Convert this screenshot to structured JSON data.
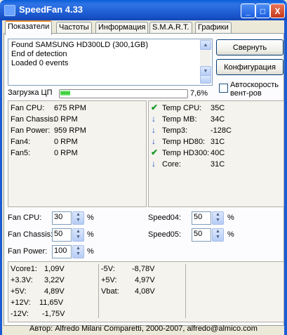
{
  "window": {
    "title": "SpeedFan 4.33",
    "minimize": "_",
    "maximize": "□",
    "close": "X"
  },
  "tabs": [
    "Показатели",
    "Частоты",
    "Информация",
    "S.M.A.R.T.",
    "Графики"
  ],
  "log": {
    "lines": [
      "Found SAMSUNG HD300LD (300,1GB)",
      "End of detection",
      "Loaded 0 events"
    ]
  },
  "buttons": {
    "minimize_label": "Свернуть",
    "config_label": "Конфигурация"
  },
  "autospeed": {
    "label_line1": "Автоскорость",
    "label_line2": "вент-ров",
    "checked": false
  },
  "cpu_load": {
    "label": "Загрузка ЦП",
    "value_text": "7,6%",
    "fraction": 0.076
  },
  "fans": [
    {
      "name": "Fan CPU:",
      "value": "675 RPM"
    },
    {
      "name": "Fan Chassis:",
      "value": "0 RPM"
    },
    {
      "name": "Fan Power:",
      "value": "959 RPM"
    },
    {
      "name": "Fan4:",
      "value": "0 RPM"
    },
    {
      "name": "Fan5:",
      "value": "0 RPM"
    }
  ],
  "temps": [
    {
      "name": "Temp CPU:",
      "value": "35C",
      "icon": "check"
    },
    {
      "name": "Temp MB:",
      "value": "34C",
      "icon": "arrow-down"
    },
    {
      "name": "Temp3:",
      "value": "-128C",
      "icon": "arrow-down"
    },
    {
      "name": "Temp HD80:",
      "value": "31C",
      "icon": "arrow-down"
    },
    {
      "name": "Temp HD300:",
      "value": "40C",
      "icon": "check"
    },
    {
      "name": "Core:",
      "value": "31C",
      "icon": "arrow-down"
    }
  ],
  "speeds": [
    {
      "label": "Fan CPU:",
      "value": "30",
      "unit": "%"
    },
    {
      "label": "Fan Chassis:",
      "value": "50",
      "unit": "%"
    },
    {
      "label": "Fan Power:",
      "value": "100",
      "unit": "%"
    },
    {
      "label": "Speed04:",
      "value": "50",
      "unit": "%"
    },
    {
      "label": "Speed05:",
      "value": "50",
      "unit": "%"
    }
  ],
  "voltages_left": [
    {
      "name": "Vcore1:",
      "value": "1,09V"
    },
    {
      "name": "+3.3V:",
      "value": "3,22V"
    },
    {
      "name": "+5V:",
      "value": "4,89V"
    },
    {
      "name": "+12V:",
      "value": "11,65V"
    },
    {
      "name": "-12V:",
      "value": "-1,75V"
    }
  ],
  "voltages_right": [
    {
      "name": "-5V:",
      "value": "-8,78V"
    },
    {
      "name": "+5V:",
      "value": "4,97V"
    },
    {
      "name": "Vbat:",
      "value": "4,08V"
    }
  ],
  "footer": {
    "text": "Автор: Alfredo Milani Comparetti, 2000-2007, alfredo@almico.com"
  }
}
